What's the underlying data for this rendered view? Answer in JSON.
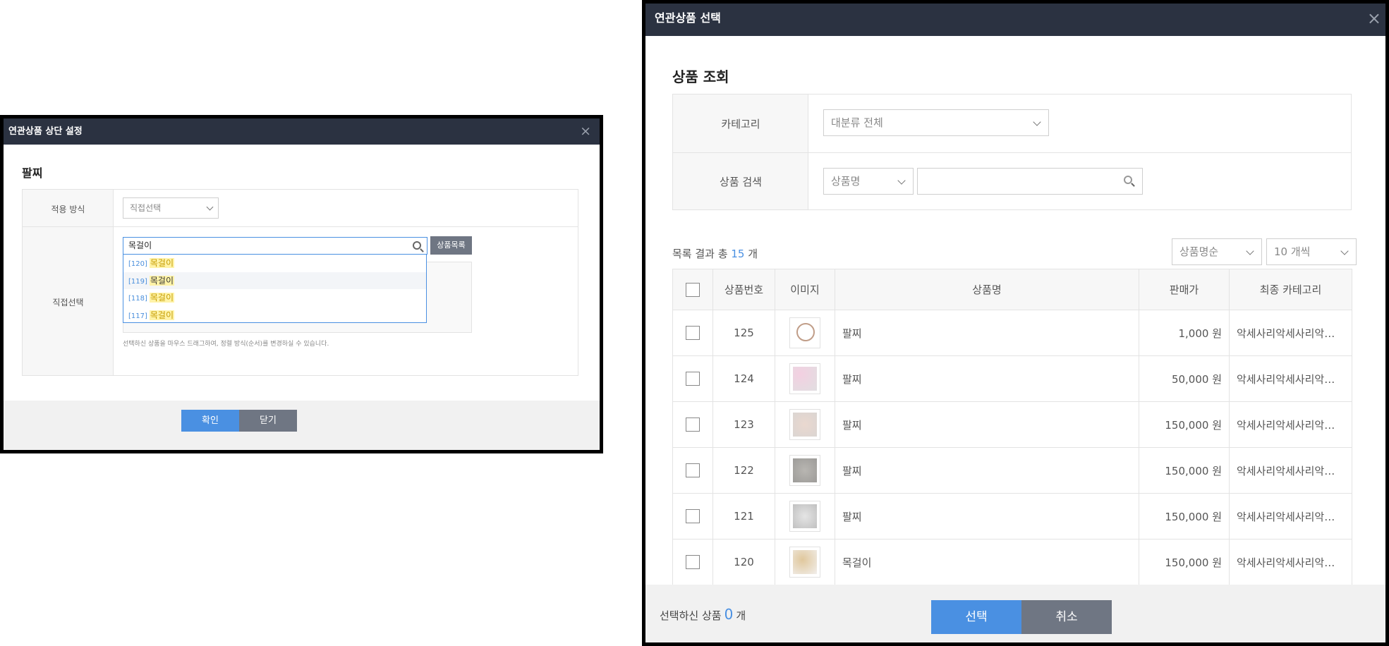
{
  "left_modal": {
    "title": "연관상품 상단 설정",
    "close_symbol": "×",
    "section_title": "팔찌",
    "apply_label": "적용 방식",
    "apply_value": "직접선택",
    "direct_label": "직접선택",
    "search_value": "목걸이",
    "list_button": "상품목록",
    "suggestions": [
      {
        "code": "[120]",
        "label": "목걸이"
      },
      {
        "code": "[119]",
        "label": "목걸이"
      },
      {
        "code": "[118]",
        "label": "목걸이"
      },
      {
        "code": "[117]",
        "label": "목걸이"
      }
    ],
    "note": "선택하신 상품을 마우스 드래그하여, 정렬 방식(순서)를 변경하실 수 있습니다.",
    "confirm_button": "확인",
    "close_button": "닫기"
  },
  "right_modal": {
    "title": "연관상품 선택",
    "close_symbol": "×",
    "section_title": "상품 조회",
    "category_label": "카테고리",
    "category_value": "대분류 전체",
    "search_label": "상품 검색",
    "search_type": "상품명",
    "search_value": "",
    "result_prefix": "목록 결과 총",
    "result_count": "15",
    "result_suffix": "개",
    "sort_value": "상품명순",
    "per_page_value": "10 개씩",
    "columns": [
      "상품번호",
      "이미지",
      "상품명",
      "판매가",
      "최종 카테고리"
    ],
    "rows": [
      {
        "num": "125",
        "name": "팔찌",
        "price": "1,000 원",
        "category": "악세사리악세사리악…"
      },
      {
        "num": "124",
        "name": "팔찌",
        "price": "50,000 원",
        "category": "악세사리악세사리악…"
      },
      {
        "num": "123",
        "name": "팔찌",
        "price": "150,000 원",
        "category": "악세사리악세사리악…"
      },
      {
        "num": "122",
        "name": "팔찌",
        "price": "150,000 원",
        "category": "악세사리악세사리악…"
      },
      {
        "num": "121",
        "name": "팔찌",
        "price": "150,000 원",
        "category": "악세사리악세사리악…"
      },
      {
        "num": "120",
        "name": "목걸이",
        "price": "150,000 원",
        "category": "악세사리악세사리악…"
      }
    ],
    "selected_prefix": "선택하신 상품",
    "selected_count": "0",
    "selected_suffix": "개",
    "select_button": "선택",
    "cancel_button": "취소"
  }
}
